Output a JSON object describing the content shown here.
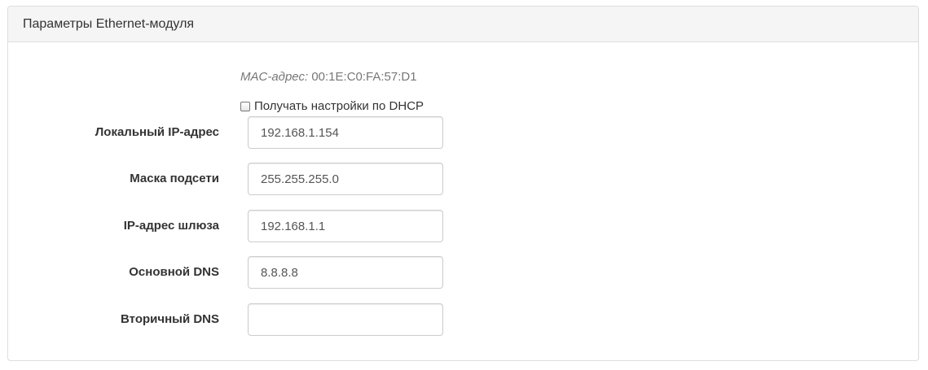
{
  "panel": {
    "title": "Параметры Ethernet-модуля"
  },
  "mac": {
    "label": "MAC-адрес:",
    "value": "00:1E:C0:FA:57:D1"
  },
  "dhcp": {
    "label": "Получать настройки по DHCP",
    "checked": false
  },
  "fields": [
    {
      "label": "Локальный IP-адрес",
      "value": "192.168.1.154"
    },
    {
      "label": "Маска подсети",
      "value": "255.255.255.0"
    },
    {
      "label": "IP-адрес шлюза",
      "value": "192.168.1.1"
    },
    {
      "label": "Основной DNS",
      "value": "8.8.8.8"
    },
    {
      "label": "Вторичный DNS",
      "value": ""
    }
  ]
}
